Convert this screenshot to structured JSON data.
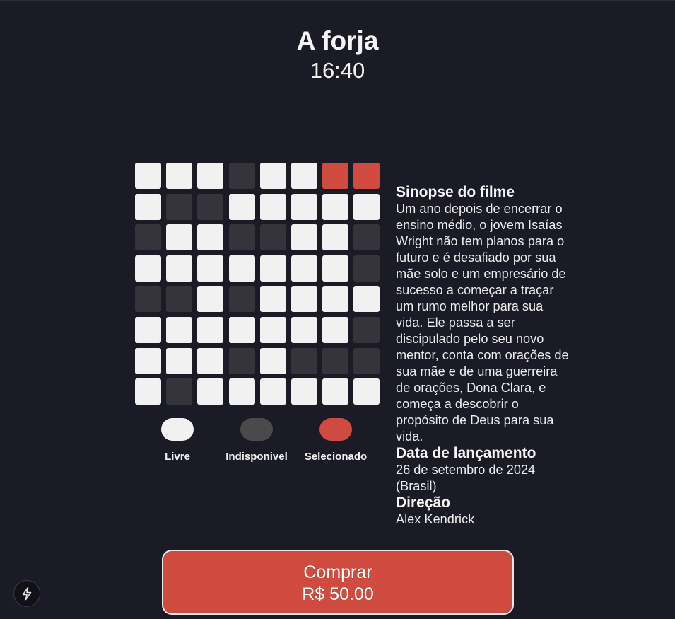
{
  "movie": {
    "title": "A forja",
    "time": "16:40"
  },
  "seats": {
    "rows": [
      [
        "free",
        "free",
        "free",
        "unavailable",
        "free",
        "free",
        "selected",
        "selected"
      ],
      [
        "free",
        "unavailable",
        "unavailable",
        "free",
        "free",
        "free",
        "free",
        "free"
      ],
      [
        "unavailable",
        "free",
        "free",
        "unavailable",
        "unavailable",
        "free",
        "free",
        "unavailable"
      ],
      [
        "free",
        "free",
        "free",
        "free",
        "free",
        "free",
        "free",
        "unavailable"
      ],
      [
        "unavailable",
        "unavailable",
        "free",
        "unavailable",
        "free",
        "free",
        "free",
        "free"
      ],
      [
        "free",
        "free",
        "free",
        "free",
        "free",
        "free",
        "free",
        "unavailable"
      ],
      [
        "free",
        "free",
        "free",
        "unavailable",
        "free",
        "unavailable",
        "unavailable",
        "unavailable"
      ],
      [
        "free",
        "unavailable",
        "free",
        "free",
        "free",
        "free",
        "free",
        "free"
      ]
    ]
  },
  "legend": {
    "free": "Livre",
    "unavailable": "Indisponivel",
    "selected": "Selecionado"
  },
  "info": {
    "synopsis_heading": "Sinopse do filme",
    "synopsis": "Um ano depois de encerrar o ensino médio, o jovem Isaías Wright não tem planos para o futuro e é desafiado por sua mãe solo e um empresário de sucesso a começar a traçar um rumo melhor para sua vida. Ele passa a ser discipulado pelo seu novo mentor, conta com orações de sua mãe e de uma guerreira de orações, Dona Clara, e começa a descobrir o propósito de Deus para sua vida.",
    "release_heading": "Data de lançamento",
    "release_date": "26 de setembro de 2024 (Brasil)",
    "direction_heading": "Direção",
    "director": "Alex Kendrick"
  },
  "buy": {
    "label": "Comprar",
    "price": "R$ 50.00"
  },
  "colors": {
    "background": "#1b1b25",
    "seat_free": "#f1f1f1",
    "seat_unavailable": "#34343a",
    "seat_selected": "#cf4a3f",
    "button": "#cf4a3f"
  },
  "icons": {
    "fab": "lightning-bolt-icon"
  }
}
